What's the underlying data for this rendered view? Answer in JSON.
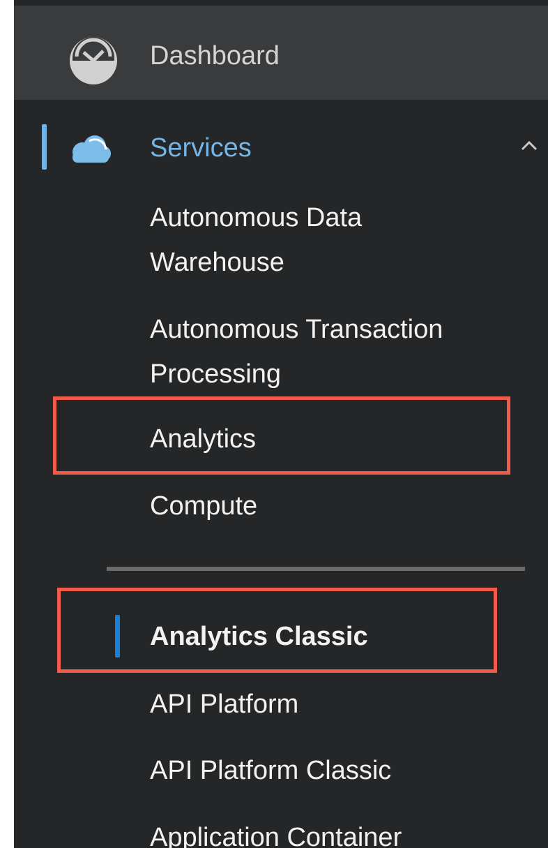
{
  "nav": {
    "dashboard": {
      "label": "Dashboard",
      "icon": "dashboard-gauge-icon"
    },
    "services": {
      "label": "Services",
      "icon": "cloud-icon",
      "expanded": true,
      "collapse_icon": "chevron-up-icon"
    },
    "items": [
      {
        "line1": "Autonomous Data",
        "line2": "Warehouse"
      },
      {
        "line1": "Autonomous Transaction",
        "line2": "Processing"
      },
      {
        "label": "Analytics",
        "highlighted": true
      },
      {
        "label": "Compute"
      }
    ],
    "classic_items": [
      {
        "label": "Analytics Classic",
        "selected": true,
        "highlighted": true
      },
      {
        "label": "API Platform"
      },
      {
        "label": "API Platform Classic"
      },
      {
        "label": "Application Container"
      }
    ]
  },
  "colors": {
    "background": "#252627",
    "dashboard_row": "#3a3b3c",
    "services_text": "#76b6e6",
    "item_text": "#f2f2f2",
    "highlight_box": "#f25a4a",
    "selected_indicator": "#1a7fd6"
  }
}
